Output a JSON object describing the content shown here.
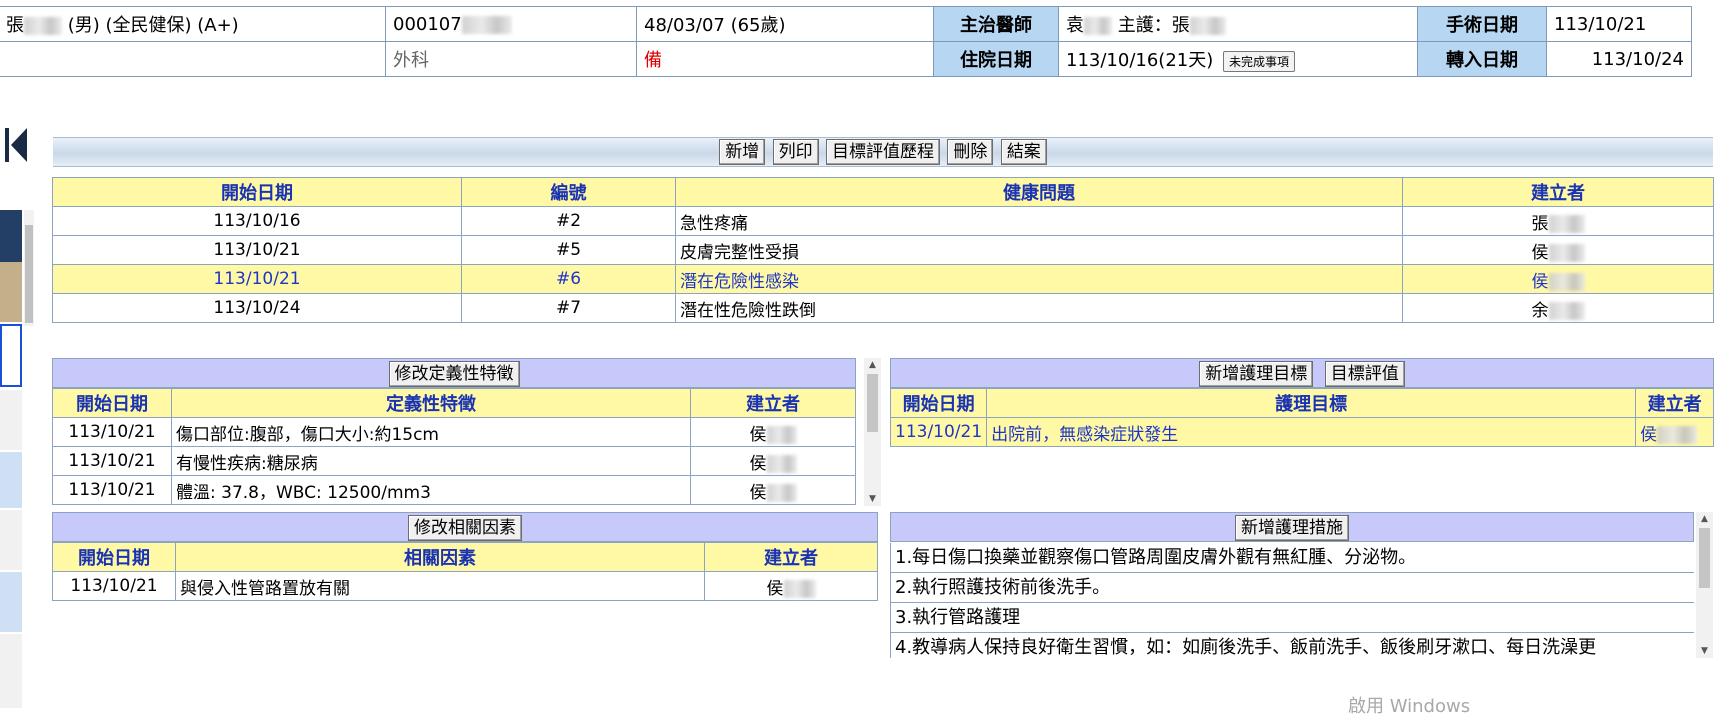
{
  "header": {
    "patient_name": "張",
    "patient_info": "(男) (全民健保) (A+)",
    "chart_no": "000107",
    "birth_age": "48/03/07 (65歲)",
    "attending_label": "主治醫師",
    "attending_name": "袁",
    "nurse_label": "主護：張",
    "surgery_date_label": "手術日期",
    "surgery_date": "113/10/21",
    "department": "外科",
    "flag": "備",
    "admission_label": "住院日期",
    "admission_date": "113/10/16(21天)",
    "pending_button": "未完成事項",
    "transfer_label": "轉入日期",
    "transfer_date": "113/10/24"
  },
  "toolbar": {
    "add": "新增",
    "print": "列印",
    "goal_history": "目標評值歷程",
    "delete": "刪除",
    "close_case": "結案"
  },
  "problems": {
    "headers": [
      "開始日期",
      "編號",
      "健康問題",
      "建立者"
    ],
    "rows": [
      {
        "date": "113/10/16",
        "no": "#2",
        "problem": "急性疼痛",
        "creator": "張"
      },
      {
        "date": "113/10/21",
        "no": "#5",
        "problem": "皮膚完整性受損",
        "creator": "侯"
      },
      {
        "date": "113/10/21",
        "no": "#6",
        "problem": "潛在危險性感染",
        "creator": "侯"
      },
      {
        "date": "113/10/24",
        "no": "#7",
        "problem": "潛在性危險性跌倒",
        "creator": "余"
      }
    ]
  },
  "characteristics": {
    "button": "修改定義性特徵",
    "headers": [
      "開始日期",
      "定義性特徵",
      "建立者"
    ],
    "rows": [
      {
        "date": "113/10/21",
        "text": "傷口部位:腹部，傷口大小:約15cm",
        "creator": "侯"
      },
      {
        "date": "113/10/21",
        "text": "有慢性疾病:糖尿病",
        "creator": "侯"
      },
      {
        "date": "113/10/21",
        "text": "體溫: 37.8，WBC: 12500/mm3",
        "creator": "侯"
      }
    ]
  },
  "goals": {
    "add_button": "新增護理目標",
    "eval_button": "目標評值",
    "headers": [
      "開始日期",
      "護理目標",
      "建立者"
    ],
    "rows": [
      {
        "date": "113/10/21",
        "text": "出院前，無感染症狀發生",
        "creator": "侯"
      }
    ]
  },
  "factors": {
    "button": "修改相關因素",
    "headers": [
      "開始日期",
      "相關因素",
      "建立者"
    ],
    "rows": [
      {
        "date": "113/10/21",
        "text": "與侵入性管路置放有關",
        "creator": "侯"
      }
    ]
  },
  "measures": {
    "button": "新增護理措施",
    "items": [
      "1.每日傷口換藥並觀察傷口管路周圍皮膚外觀有無紅腫、分泌物。",
      "2.執行照護技術前後洗手。",
      "3.執行管路護理",
      "4.教導病人保持良好衛生習慣，如：如廁後洗手、飯前洗手、飯後刷牙漱口、每日洗澡更"
    ]
  },
  "watermark": "啟用 Windows",
  "colors": {
    "label_bg": "#b7d6f1",
    "table_header_bg": "#fff9a6",
    "header_text": "#1a33b3",
    "panel_head_bg": "#c8c9fb",
    "selected_text": "#1f35c6",
    "flag_red": "#e00000"
  }
}
